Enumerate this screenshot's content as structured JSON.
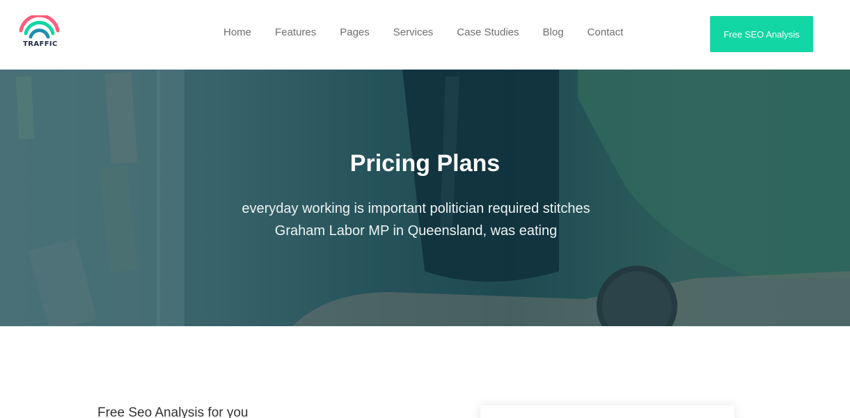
{
  "brand": {
    "name": "TRAFFIC",
    "colors": {
      "arc_top": "#ff5d7a",
      "arc_mid": "#12d6a3",
      "arc_bottom": "#1e8fb0"
    }
  },
  "nav": {
    "items": [
      "Home",
      "Features",
      "Pages",
      "Services",
      "Case Studies",
      "Blog",
      "Contact"
    ]
  },
  "cta": {
    "label": "Free SEO Analysis",
    "color": "#12d6a3"
  },
  "hero": {
    "title": "Pricing Plans",
    "subtitle_line1": "everyday working is important politician required stitches",
    "subtitle_line2": "Graham Labor MP in Queensland, was eating"
  },
  "section": {
    "title": "Free Seo Analysis for you"
  }
}
